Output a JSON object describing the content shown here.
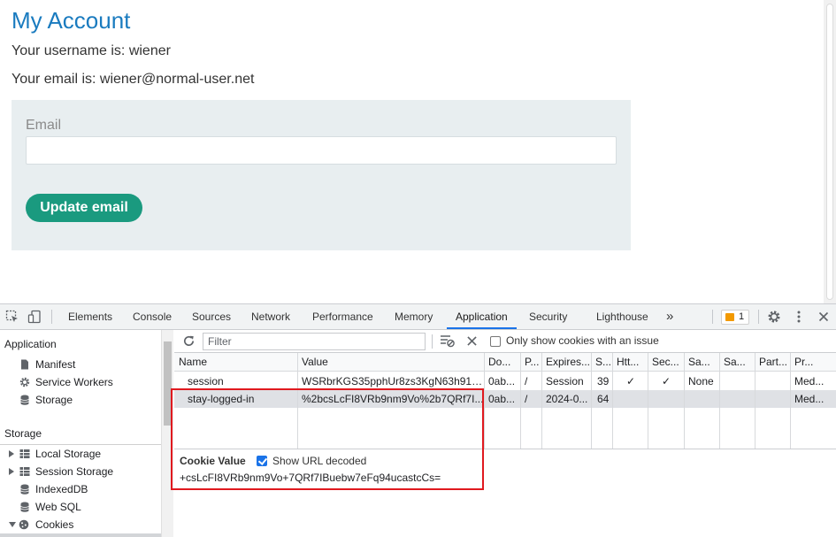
{
  "page": {
    "title": "My Account",
    "username_line": "Your username is: wiener",
    "email_line": "Your email is: wiener@normal-user.net",
    "form": {
      "email_label": "Email",
      "email_value": "",
      "update_button": "Update email"
    }
  },
  "devtools": {
    "tabs": [
      "Elements",
      "Console",
      "Sources",
      "Network",
      "Performance",
      "Memory",
      "Application",
      "Security",
      "Lighthouse"
    ],
    "active_tab": "Application",
    "more_tabs": "»",
    "issues_count": "1",
    "sidebar": {
      "application_header": "Application",
      "application_items": [
        "Manifest",
        "Service Workers",
        "Storage"
      ],
      "storage_header": "Storage",
      "storage_items": [
        "Local Storage",
        "Session Storage",
        "IndexedDB",
        "Web SQL",
        "Cookies"
      ]
    },
    "filter": {
      "placeholder": "Filter",
      "only_issue_label": "Only show cookies with an issue"
    },
    "columns": [
      "Name",
      "Value",
      "Do...",
      "P...",
      "Expires...",
      "S...",
      "Htt...",
      "Sec...",
      "Sa...",
      "Sa...",
      "Part...",
      "Pr..."
    ],
    "rows": [
      [
        "session",
        "WSRbrKGS35pphUr8zs3KgN63h91C...",
        "0ab...",
        "/",
        "Session",
        "39",
        "✓",
        "✓",
        "None",
        "",
        "",
        "Med..."
      ],
      [
        "stay-logged-in",
        "%2bcsLcFI8VRb9nm9Vo%2b7QRf7I...",
        "0ab...",
        "/",
        "2024-0...",
        "64",
        "",
        "",
        "",
        "",
        "",
        "Med..."
      ]
    ],
    "selected_row": 1,
    "cookie_value": {
      "label": "Cookie Value",
      "show_decoded_label": "Show URL decoded",
      "show_decoded_checked": true,
      "value": "+csLcFI8VRb9nm9Vo+7QRf7IBuebw7eFq94ucastcCs="
    }
  },
  "colors": {
    "title": "#1a7bbf",
    "button": "#1a9a7f",
    "highlight": "#e0191f",
    "accent": "#1a73e8"
  }
}
